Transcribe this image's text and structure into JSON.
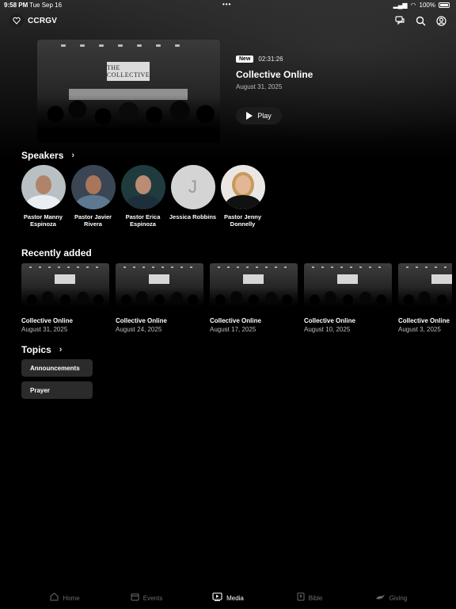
{
  "status_bar": {
    "time": "9:58 PM",
    "date": "Tue Sep 16",
    "battery": "100%"
  },
  "header": {
    "brand": "CCRGV",
    "icons": [
      "chat-icon",
      "search-icon",
      "account-icon"
    ]
  },
  "hero": {
    "image_text": "THE COLLECTIVE",
    "badge": "New",
    "duration": "02:31:26",
    "title": "Collective Online",
    "date": "August 31, 2025",
    "play_label": "Play"
  },
  "speakers": {
    "title": "Speakers",
    "items": [
      {
        "name": "Pastor Manny Espinoza",
        "initial": ""
      },
      {
        "name": "Pastor Javier Rivera",
        "initial": ""
      },
      {
        "name": "Pastor Erica Espinoza",
        "initial": ""
      },
      {
        "name": "Jessica Robbins",
        "initial": "J"
      },
      {
        "name": "Pastor Jenny Donnelly",
        "initial": ""
      }
    ]
  },
  "recent": {
    "title": "Recently added",
    "items": [
      {
        "title": "Collective Online",
        "date": "August 31, 2025"
      },
      {
        "title": "Collective Online",
        "date": "August 24, 2025"
      },
      {
        "title": "Collective Online",
        "date": "August 17, 2025"
      },
      {
        "title": "Collective Online",
        "date": "August 10, 2025"
      },
      {
        "title": "Collective Online",
        "date": "August 3, 2025"
      }
    ]
  },
  "topics": {
    "title": "Topics",
    "items": [
      "Announcements",
      "Prayer"
    ]
  },
  "tabs": [
    {
      "label": "Home",
      "icon": "home-icon",
      "active": false
    },
    {
      "label": "Events",
      "icon": "calendar-icon",
      "active": false
    },
    {
      "label": "Media",
      "icon": "media-icon",
      "active": true
    },
    {
      "label": "Bible",
      "icon": "bible-icon",
      "active": false
    },
    {
      "label": "Giving",
      "icon": "giving-icon",
      "active": false
    }
  ],
  "colors": {
    "background": "#000000",
    "chip": "#2b2b2b",
    "inactive_tab": "#6d6d6d"
  }
}
